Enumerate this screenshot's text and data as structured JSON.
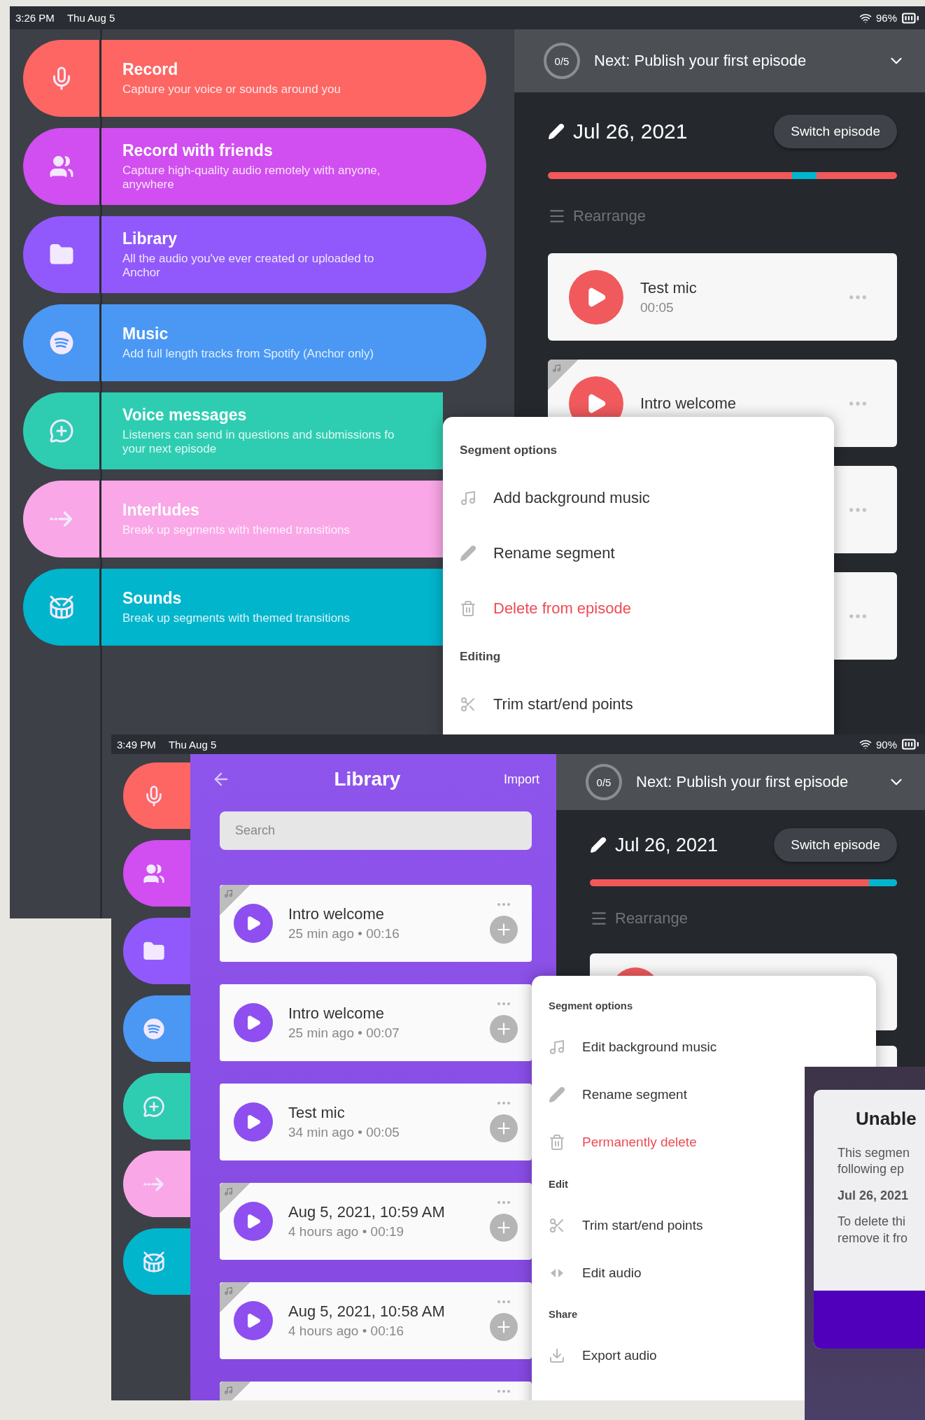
{
  "screens": [
    {
      "status_bar": {
        "time": "3:26 PM",
        "date": "Thu Aug 5",
        "battery": "96%"
      },
      "tools": [
        {
          "kind": "record",
          "color": "#fd6663",
          "title": "Record",
          "subtitle": "Capture your voice or sounds around you"
        },
        {
          "kind": "friends",
          "color": "#d14ef0",
          "title": "Record with friends",
          "subtitle": "Capture high-quality audio remotely with anyone, anywhere"
        },
        {
          "kind": "library",
          "color": "#9159fc",
          "title": "Library",
          "subtitle": "All the audio you've ever created or uploaded to Anchor"
        },
        {
          "kind": "music",
          "color": "#4a98f4",
          "title": "Music",
          "subtitle": "Add full length tracks from Spotify (Anchor only)"
        },
        {
          "kind": "messages",
          "color": "#2ecdb2",
          "title": "Voice messages",
          "subtitle": "Listeners can send in questions and submissions fo your next episode"
        },
        {
          "kind": "interludes",
          "color": "#f9a7e6",
          "title": "Interludes",
          "subtitle": "Break up segments with themed transitions"
        },
        {
          "kind": "sounds",
          "color": "#00b5cc",
          "title": "Sounds",
          "subtitle": "Break up segments with themed transitions"
        }
      ],
      "checklist": {
        "progress": "0/5",
        "title": "Next: Publish your first episode"
      },
      "episode": {
        "date": "Jul 26, 2021",
        "switch": "Switch episode",
        "rearrange": "Rearrange"
      },
      "segments": [
        {
          "title": "Test mic",
          "duration": "00:05",
          "music": false
        },
        {
          "title": "Intro welcome",
          "music": true
        },
        {
          "music": false
        },
        {
          "music": false
        }
      ],
      "menu": {
        "sections": [
          {
            "heading": "Segment options",
            "items": [
              {
                "kind": "music",
                "label": "Add background music"
              },
              {
                "kind": "rename",
                "label": "Rename segment"
              },
              {
                "kind": "delete",
                "label": "Delete from episode"
              }
            ]
          },
          {
            "heading": "Editing",
            "items": [
              {
                "kind": "trim",
                "label": "Trim start/end points"
              }
            ]
          }
        ]
      }
    },
    {
      "status_bar": {
        "time": "3:49 PM",
        "date": "Thu Aug 5",
        "battery": "90%"
      },
      "tools": [
        {
          "kind": "record",
          "color": "#fd6663"
        },
        {
          "kind": "friends",
          "color": "#d14ef0"
        },
        {
          "kind": "library",
          "color": "#9159fc"
        },
        {
          "kind": "music",
          "color": "#4a98f4"
        },
        {
          "kind": "messages",
          "color": "#2ecdb2"
        },
        {
          "kind": "interludes",
          "color": "#f9a7e6"
        },
        {
          "kind": "sounds",
          "color": "#00b5cc"
        }
      ],
      "library": {
        "title": "Library",
        "action": "Import",
        "search": {
          "placeholder": "Search"
        },
        "items": [
          {
            "title": "Intro welcome",
            "meta": "25 min ago • 00:16",
            "music": true
          },
          {
            "title": "Intro welcome",
            "meta": "25 min ago • 00:07",
            "music": false
          },
          {
            "title": "Test mic",
            "meta": "34 min ago • 00:05",
            "music": false
          },
          {
            "title": "Aug 5, 2021, 10:59 AM",
            "meta": "4 hours ago • 00:19",
            "music": true
          },
          {
            "title": "Aug 5, 2021, 10:58 AM",
            "meta": "4 hours ago • 00:16",
            "music": true
          },
          {
            "music": true
          }
        ]
      },
      "checklist": {
        "progress": "0/5",
        "title": "Next: Publish your first episode"
      },
      "episode": {
        "date": "Jul 26, 2021",
        "switch": "Switch episode",
        "rearrange": "Rearrange"
      },
      "segments": [
        {
          "music": false
        },
        {
          "music": false
        }
      ],
      "menu": {
        "sections": [
          {
            "heading": "Segment options",
            "items": [
              {
                "kind": "music",
                "label": "Edit background music"
              },
              {
                "kind": "rename",
                "label": "Rename segment"
              },
              {
                "kind": "delete",
                "label": "Permanently delete"
              }
            ]
          },
          {
            "heading": "Edit",
            "items": [
              {
                "kind": "trim",
                "label": "Trim start/end points"
              },
              {
                "kind": "edit-audio",
                "label": "Edit audio"
              }
            ]
          },
          {
            "heading": "Share",
            "items": [
              {
                "kind": "export",
                "label": "Export audio"
              }
            ]
          }
        ]
      }
    }
  ],
  "dialog": {
    "title": "Unable",
    "lines": [
      "This segmen",
      "following ep"
    ],
    "episode": "Jul 26, 2021",
    "note_lines": [
      "To delete thi",
      "remove it fro"
    ]
  }
}
